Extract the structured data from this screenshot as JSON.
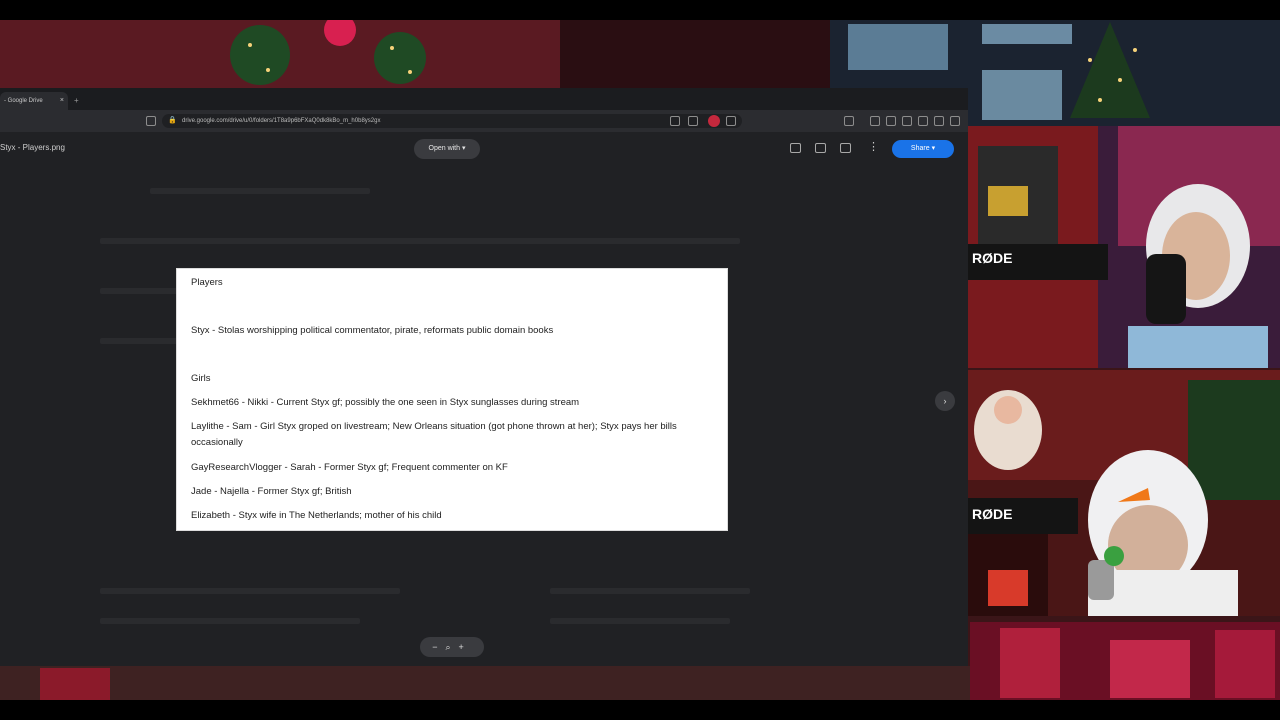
{
  "browser": {
    "tab_title": "- Google Drive",
    "url": "drive.google.com/drive/u/0/folders/1T8a9p6bFXaQ0dk8kBo_m_h0b8ys2gx",
    "file_name": "Styx - Players.png",
    "open_with_label": "Open with",
    "share_label": "Share"
  },
  "document": {
    "heading": "Players",
    "styx_line": "Styx - Stolas worshipping political commentator, pirate, reformats public domain books",
    "girls_heading": "Girls",
    "entries": [
      "Sekhmet66 - Nikki - Current Styx gf; possibly the one seen in Styx sunglasses during stream",
      "Laylithe - Sam - Girl Styx groped on livestream; New Orleans situation (got phone thrown at her); Styx pays her bills occasionally",
      "GayResearchVlogger - Sarah - Former Styx gf; Frequent commenter on KF",
      "Jade - Najella - Former Styx gf; British",
      "Elizabeth - Styx wife in The Netherlands; mother of his child"
    ]
  },
  "webcams": {
    "mic_brand_1": "RØDE",
    "mic_brand_2": "RØDE"
  },
  "colors": {
    "browser_bg": "#202124",
    "share_blue": "#1a73e8",
    "wall_red": "#5a1a22"
  },
  "icons": [
    "lock-icon",
    "zoom-out-icon",
    "zoom-in-icon",
    "next-arrow-icon",
    "print-icon",
    "comment-icon",
    "folder-icon",
    "more-icon"
  ]
}
